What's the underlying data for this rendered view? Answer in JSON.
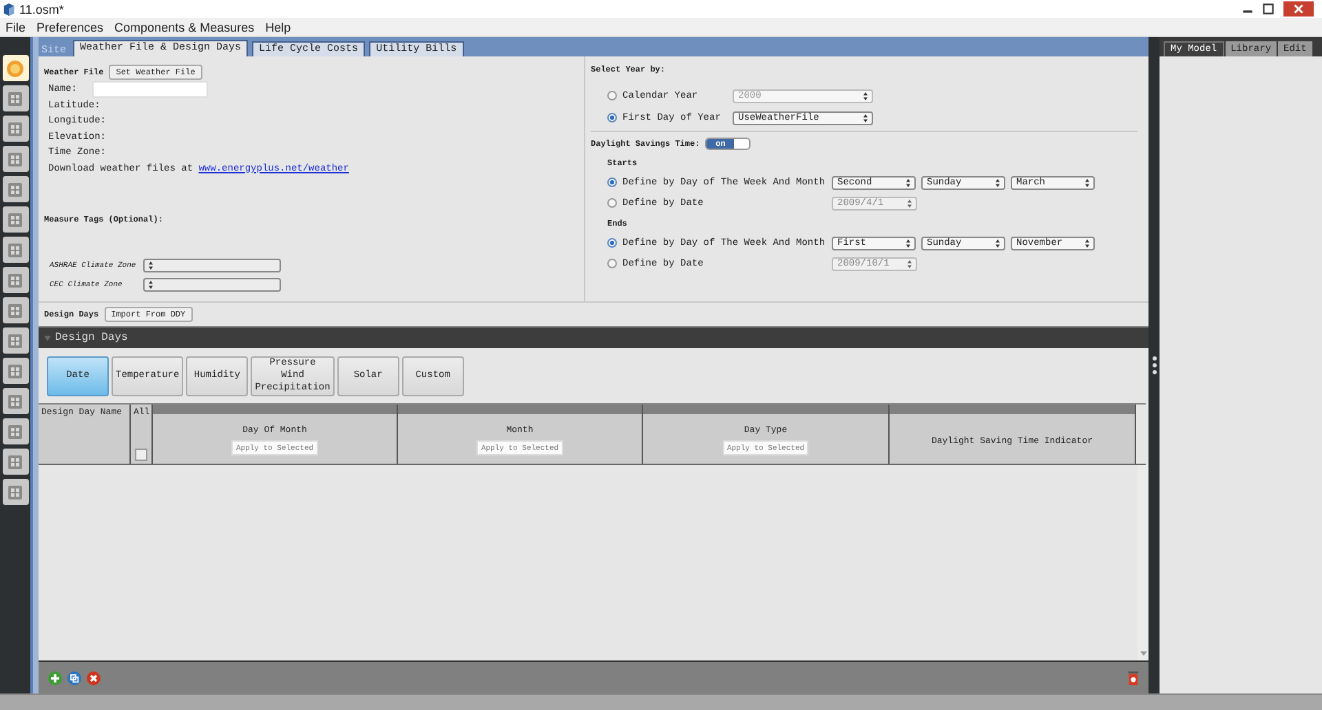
{
  "window": {
    "title": "11.osm*"
  },
  "menu": [
    "File",
    "Preferences",
    "Components & Measures",
    "Help"
  ],
  "sidebar_items": [
    {
      "selected": true
    },
    {
      "selected": false
    },
    {
      "selected": false
    },
    {
      "selected": false
    },
    {
      "selected": false
    },
    {
      "selected": false
    },
    {
      "selected": false
    },
    {
      "selected": false
    },
    {
      "selected": false
    },
    {
      "selected": false
    },
    {
      "selected": false
    },
    {
      "selected": false
    },
    {
      "selected": false
    },
    {
      "selected": false
    },
    {
      "selected": false
    }
  ],
  "page_title": "Site",
  "tabs": [
    {
      "label": "Weather File & Design Days",
      "selected": true
    },
    {
      "label": "Life Cycle Costs",
      "selected": false
    },
    {
      "label": "Utility Bills",
      "selected": false
    }
  ],
  "weather_file": {
    "heading": "Weather File",
    "button": "Set Weather File",
    "name_label": "Name:",
    "fields": [
      "Latitude:",
      "Longitude:",
      "Elevation:",
      "Time Zone:"
    ],
    "download_text": "Download weather files at",
    "download_link": "www.energyplus.net/weather"
  },
  "measure_tags": {
    "heading": "Measure Tags (Optional):",
    "dropdowns": [
      {
        "label": "ASHRAE Climate Zone"
      },
      {
        "label": "CEC Climate Zone"
      }
    ]
  },
  "select_year": {
    "heading": "Select Year by:",
    "options": [
      {
        "label": "Calendar Year",
        "selected": false,
        "value": "2000",
        "disabled": true
      },
      {
        "label": "First Day of Year",
        "selected": true,
        "value": "UseWeatherFile",
        "disabled": false
      }
    ]
  },
  "daylight_savings": {
    "label": "Daylight Savings Time:",
    "toggle_text": "on",
    "on": true
  },
  "periods": [
    {
      "heading": "Starts",
      "options": [
        {
          "kind": "week",
          "label": "Define by Day of The Week And Month",
          "selected": true,
          "values": [
            "Second",
            "Sunday",
            "March"
          ]
        },
        {
          "kind": "date",
          "label": "Define by Date",
          "selected": false,
          "values": [
            "2009/4/1"
          ]
        }
      ]
    },
    {
      "heading": "Ends",
      "options": [
        {
          "kind": "week",
          "label": "Define by Day of The Week And Month",
          "selected": true,
          "values": [
            "First",
            "Sunday",
            "November"
          ]
        },
        {
          "kind": "date",
          "label": "Define by Date",
          "selected": false,
          "values": [
            "2009/10/1"
          ]
        }
      ]
    }
  ],
  "design_days": {
    "label": "Design Days",
    "import_button": "Import From DDY",
    "section_title": "Design Days"
  },
  "category_tabs": [
    {
      "label": "Date",
      "selected": true
    },
    {
      "label": "Temperature",
      "selected": false
    },
    {
      "label": "Humidity",
      "selected": false
    },
    {
      "label": "Pressure\nWind\nPrecipitation",
      "selected": false
    },
    {
      "label": "Solar",
      "selected": false
    },
    {
      "label": "Custom",
      "selected": false
    }
  ],
  "table": {
    "columns": [
      {
        "kind": "name",
        "title": "Design Day Name"
      },
      {
        "kind": "check",
        "title": "All",
        "checked": false
      },
      {
        "kind": "apply",
        "title": "Day Of Month",
        "button": "Apply to Selected"
      },
      {
        "kind": "apply",
        "title": "Month",
        "button": "Apply to Selected"
      },
      {
        "kind": "apply",
        "title": "Day Type",
        "button": "Apply to Selected"
      },
      {
        "kind": "plain",
        "title": "Daylight Saving Time Indicator"
      }
    ]
  },
  "right_panel": {
    "tabs": [
      {
        "label": "My Model",
        "selected": true
      },
      {
        "label": "Library",
        "selected": false
      },
      {
        "label": "Edit",
        "selected": false
      }
    ]
  }
}
